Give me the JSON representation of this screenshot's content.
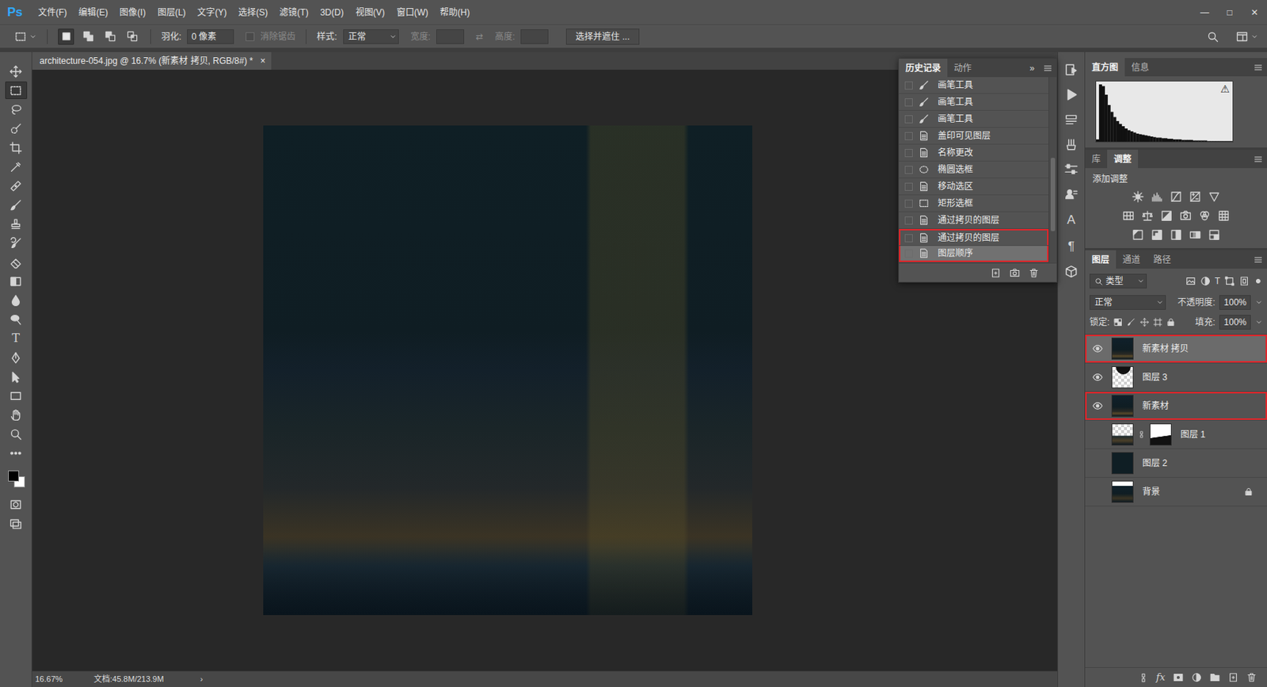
{
  "app": {
    "logo": "Ps"
  },
  "menu": [
    "文件(F)",
    "编辑(E)",
    "图像(I)",
    "图层(L)",
    "文字(Y)",
    "选择(S)",
    "滤镜(T)",
    "3D(D)",
    "视图(V)",
    "窗口(W)",
    "帮助(H)"
  ],
  "window_controls": [
    "—",
    "□",
    "✕"
  ],
  "options": {
    "selection_modes": [
      {
        "selected": true
      },
      {
        "selected": false
      },
      {
        "selected": false
      },
      {
        "selected": false
      }
    ],
    "feather_label": "羽化:",
    "feather_value": "0 像素",
    "antialias": {
      "label": "消除锯齿",
      "checked": false,
      "disabled": true
    },
    "style_label": "样式:",
    "style_value": "正常",
    "width": {
      "label": "宽度:",
      "disabled": true
    },
    "swap_glyph": "⇄",
    "height": {
      "label": "高度:",
      "disabled": true
    },
    "mask_button": "选择并遮住 ..."
  },
  "document_tab": {
    "title": "architecture-054.jpg @ 16.7% (新素材 拷贝, RGB/8#) *",
    "close": "×",
    "selected": true
  },
  "tools": [
    {
      "kind": "move",
      "selected": false
    },
    {
      "kind": "marquee",
      "selected": true
    },
    {
      "kind": "lasso",
      "selected": false
    },
    {
      "kind": "quick-select",
      "selected": false
    },
    {
      "kind": "crop",
      "selected": false
    },
    {
      "kind": "eyedropper",
      "selected": false
    },
    {
      "kind": "healing",
      "selected": false
    },
    {
      "kind": "brush",
      "selected": false
    },
    {
      "kind": "stamp",
      "selected": false
    },
    {
      "kind": "history-brush",
      "selected": false
    },
    {
      "kind": "eraser",
      "selected": false
    },
    {
      "kind": "gradient",
      "selected": false
    },
    {
      "kind": "blur",
      "selected": false
    },
    {
      "kind": "dodge",
      "selected": false
    },
    {
      "kind": "type",
      "glyph": "T",
      "selected": false
    },
    {
      "kind": "pen",
      "selected": false
    },
    {
      "kind": "path-select",
      "selected": false
    },
    {
      "kind": "rectangle",
      "selected": false
    },
    {
      "kind": "hand",
      "selected": false
    },
    {
      "kind": "zoom",
      "selected": false
    },
    {
      "kind": "more",
      "selected": false
    },
    {
      "kind": "colors",
      "foreground": "#000000",
      "background": "#ffffff",
      "selected": false
    },
    {
      "kind": "quick-mask",
      "selected": false
    },
    {
      "kind": "screen-mode",
      "selected": false
    }
  ],
  "history": {
    "tabs": [
      {
        "label": "历史记录",
        "selected": true
      },
      {
        "label": "动作",
        "selected": false
      }
    ],
    "expand": "»",
    "items": [
      {
        "label": "画笔工具",
        "kind": "brush",
        "selected": false,
        "annotated": false
      },
      {
        "label": "画笔工具",
        "kind": "brush",
        "selected": false,
        "annotated": false
      },
      {
        "label": "画笔工具",
        "kind": "brush",
        "selected": false,
        "annotated": false
      },
      {
        "label": "盖印可见图层",
        "kind": "layer",
        "selected": false,
        "annotated": false
      },
      {
        "label": "名称更改",
        "kind": "layer",
        "selected": false,
        "annotated": false
      },
      {
        "label": "椭圆选框",
        "kind": "ellipse",
        "selected": false,
        "annotated": false
      },
      {
        "label": "移动选区",
        "kind": "layer",
        "selected": false,
        "annotated": false
      },
      {
        "label": "矩形选框",
        "kind": "rect-select",
        "selected": false,
        "annotated": false
      },
      {
        "label": "通过拷贝的图层",
        "kind": "layer",
        "selected": false,
        "annotated": false
      },
      {
        "label": "通过拷贝的图层",
        "kind": "layer",
        "selected": false,
        "annotated": true
      },
      {
        "label": "图层顺序",
        "kind": "layer",
        "selected": true,
        "annotated": true
      }
    ]
  },
  "icon_column": [
    {
      "kind": "history"
    },
    {
      "kind": "play"
    },
    {
      "kind": "props"
    },
    {
      "kind": "brush-set"
    },
    {
      "kind": "sliders"
    },
    {
      "kind": "clone"
    },
    {
      "kind": "char",
      "glyph": "A"
    },
    {
      "kind": "para",
      "glyph": "¶"
    },
    {
      "kind": "cube"
    }
  ],
  "histogram": {
    "tabs": [
      {
        "label": "直方图",
        "selected": true
      },
      {
        "label": "信息",
        "selected": false
      }
    ],
    "warning": "⚠",
    "values": [
      4,
      100,
      97,
      82,
      64,
      52,
      43,
      36,
      31,
      27,
      23,
      20,
      18,
      16,
      14,
      13,
      12,
      11,
      10,
      9,
      8,
      7,
      7,
      6,
      6,
      5,
      5,
      4,
      4,
      4,
      3,
      3,
      3,
      3,
      2,
      2,
      2,
      2,
      2,
      1,
      1,
      1,
      1,
      1,
      1,
      1,
      1,
      1
    ]
  },
  "adjustments": {
    "tabs": [
      {
        "label": "库",
        "selected": false
      },
      {
        "label": "调整",
        "selected": true
      }
    ],
    "title": "添加调整"
  },
  "layers": {
    "tabs": [
      {
        "label": "图层",
        "selected": true
      },
      {
        "label": "通道",
        "selected": false
      },
      {
        "label": "路径",
        "selected": false
      }
    ],
    "filter": "类型",
    "type_glyph": "T",
    "blend": "正常",
    "opacity_label": "不透明度:",
    "opacity": "100%",
    "lock_label": "锁定:",
    "fill_label": "填充:",
    "fill": "100%",
    "fx": "fx",
    "items": [
      {
        "name": "新素材 拷贝",
        "kind": "photo",
        "visible": true,
        "selected": true,
        "annotated": true,
        "locked": false
      },
      {
        "name": "图层 3",
        "kind": "shape",
        "visible": true,
        "selected": false,
        "annotated": false,
        "locked": false
      },
      {
        "name": "新素材",
        "kind": "photo",
        "visible": true,
        "selected": false,
        "annotated": true,
        "locked": false
      },
      {
        "name": "图层 1",
        "kind": "masked",
        "visible": false,
        "selected": false,
        "annotated": false,
        "locked": false
      },
      {
        "name": "图层 2",
        "kind": "solid",
        "visible": false,
        "selected": false,
        "annotated": false,
        "locked": false
      },
      {
        "name": "背景",
        "kind": "background",
        "visible": false,
        "selected": false,
        "annotated": false,
        "locked": true
      }
    ]
  },
  "status_bar": {
    "zoom": "16.67%",
    "document": "文档:45.8M/213.9M",
    "arrow": "›"
  }
}
